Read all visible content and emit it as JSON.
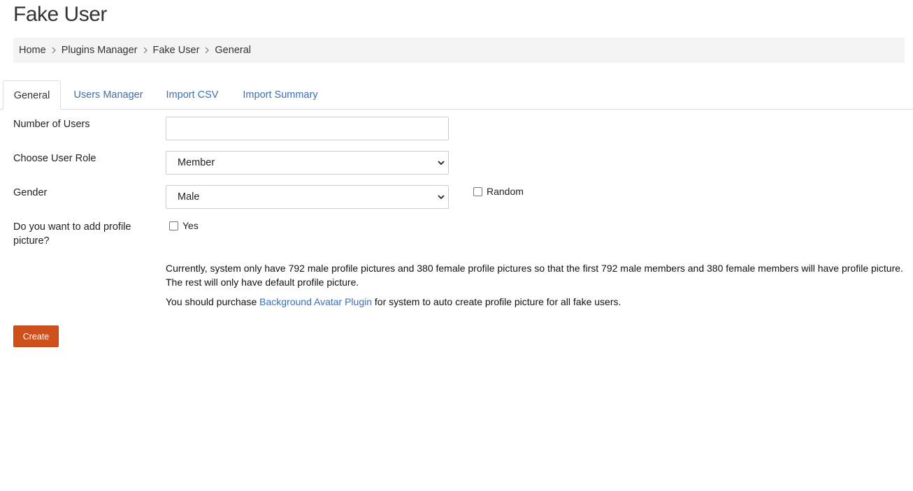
{
  "page": {
    "title": "Fake User"
  },
  "breadcrumb": {
    "items": [
      "Home",
      "Plugins Manager",
      "Fake User",
      "General"
    ]
  },
  "tabs": [
    {
      "label": "General",
      "active": true
    },
    {
      "label": "Users Manager",
      "active": false
    },
    {
      "label": "Import CSV",
      "active": false
    },
    {
      "label": "Import Summary",
      "active": false
    }
  ],
  "form": {
    "number_of_users": {
      "label": "Number of Users",
      "value": ""
    },
    "user_role": {
      "label": "Choose User Role",
      "selected": "Member"
    },
    "gender": {
      "label": "Gender",
      "selected": "Male",
      "random_label": "Random",
      "random_checked": false
    },
    "profile_picture": {
      "label": "Do you want to add profile picture?",
      "yes_label": "Yes",
      "yes_checked": false
    },
    "note_line1": "Currently, system only have 792 male profile pictures and 380 female profile pictures so that the first 792 male members and 380 female members will have profile picture.",
    "note_line2": "The rest will only have default profile picture.",
    "purchase_prefix": "You should purchase",
    "purchase_link": "Background Avatar Plugin",
    "purchase_suffix": "for system to auto create profile picture for all fake users.",
    "create_label": "Create"
  },
  "colors": {
    "accent": "#d0501c",
    "link": "#3c6fb3"
  }
}
